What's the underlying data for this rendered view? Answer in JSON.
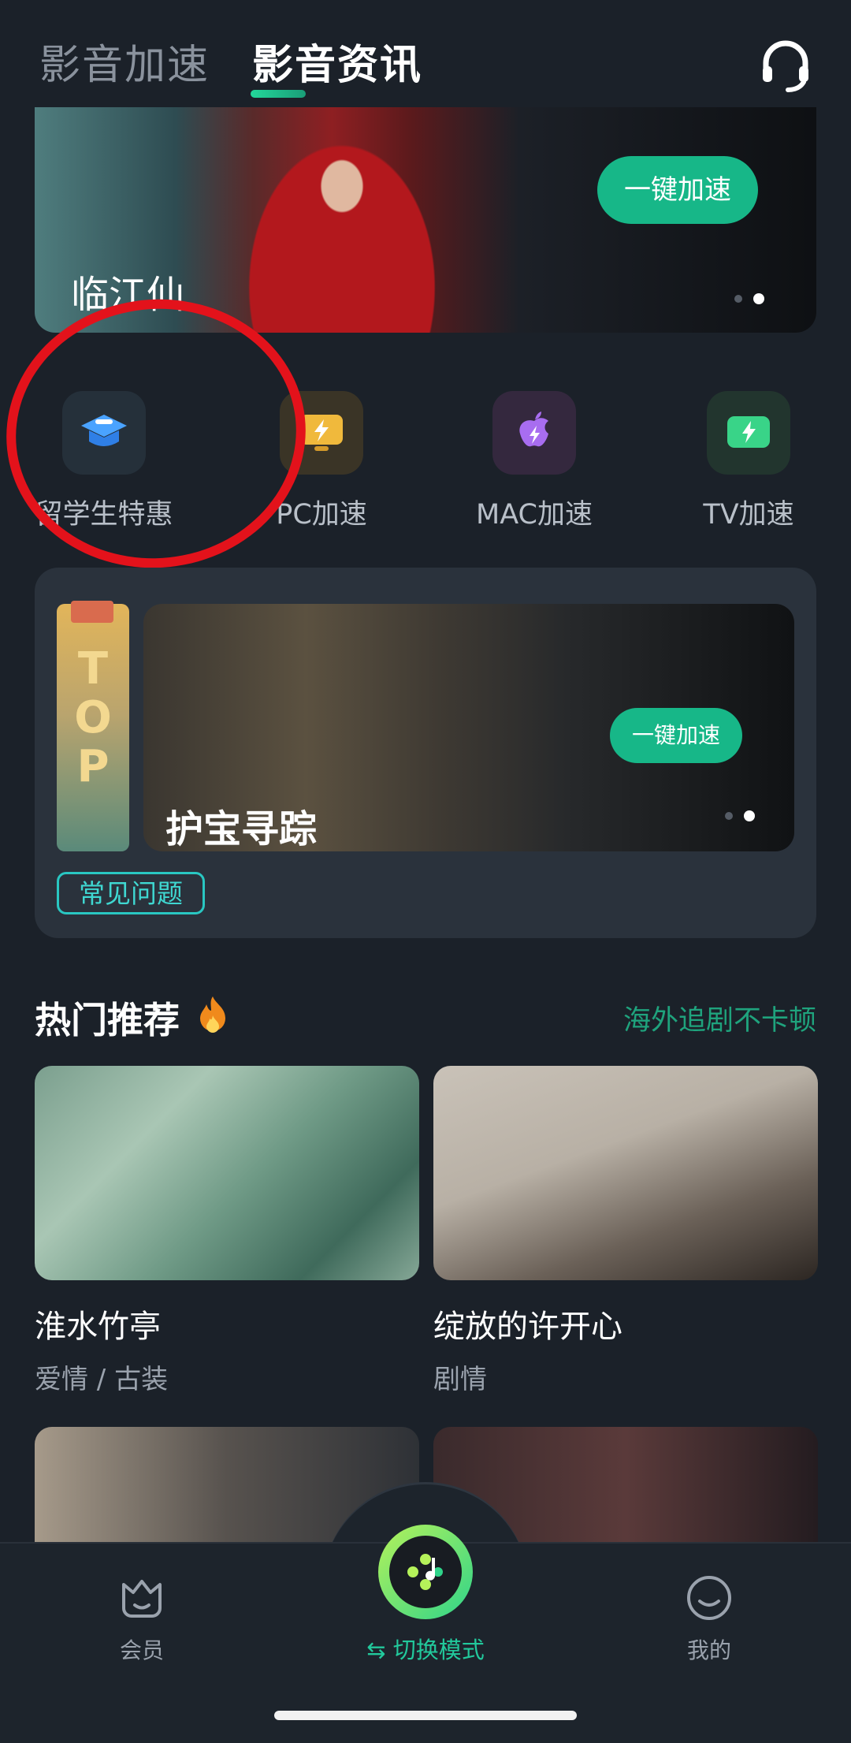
{
  "header": {
    "tabs": [
      {
        "label": "影音加速",
        "active": false
      },
      {
        "label": "影音资讯",
        "active": true
      }
    ],
    "support_icon": "headset-icon"
  },
  "banner1": {
    "title": "临江仙",
    "button": "一键加速",
    "dots": 2,
    "active_dot": 2
  },
  "quick_actions": [
    {
      "label": "留学生特惠",
      "icon": "graduation-cap-icon"
    },
    {
      "label": "PC加速",
      "icon": "monitor-lightning-icon"
    },
    {
      "label": "MAC加速",
      "icon": "apple-icon"
    },
    {
      "label": "TV加速",
      "icon": "tv-lightning-icon"
    }
  ],
  "top_section": {
    "tag": "TOP",
    "banner_title": "护宝寻踪",
    "button": "一键加速",
    "faq": "常见问题"
  },
  "hot": {
    "title": "热门推荐",
    "subtitle": "海外追剧不卡顿",
    "cards": [
      {
        "title": "淮水竹亭",
        "genre": "爱情 / 古装"
      },
      {
        "title": "绽放的许开心",
        "genre": "剧情"
      }
    ]
  },
  "nav": {
    "member": "会员",
    "switch": "⇆ 切换模式",
    "mine": "我的"
  },
  "colors": {
    "accent": "#17b788",
    "annotation_circle": "#e3121b",
    "background": "#1b2129"
  }
}
